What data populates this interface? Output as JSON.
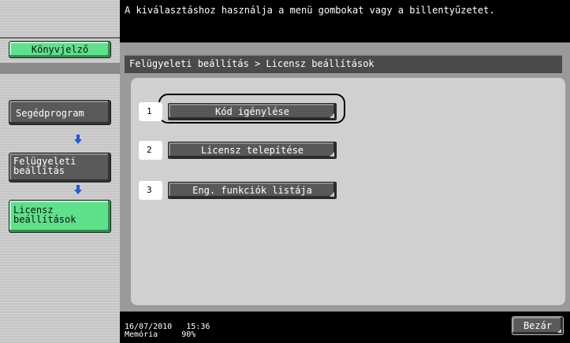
{
  "message": "A kiválasztáshoz használja a menü gombokat vagy a billentyűzetet.",
  "breadcrumb": "Felügyeleti beállítás > Licensz beállítások",
  "sidebar": {
    "bookmark_label": "Könyvjelző",
    "steps": [
      {
        "label_line1": "Segédprogram",
        "label_line2": ""
      },
      {
        "label_line1": "Felügyeleti",
        "label_line2": "beállítás"
      },
      {
        "label_line1": "Licensz",
        "label_line2": "beállítások"
      }
    ]
  },
  "options": [
    {
      "number": "1",
      "label": "Kód igénylése"
    },
    {
      "number": "2",
      "label": "Licensz telepítése"
    },
    {
      "number": "3",
      "label": "Eng. funkciók listája"
    }
  ],
  "status": {
    "date": "16/07/2010",
    "time": "15:36",
    "memory_label": "Memória",
    "memory_value": "90%"
  },
  "close_label": "Bezár",
  "colors": {
    "accent_green": "#5fe08a",
    "arrow_blue": "#1e5bd8"
  }
}
